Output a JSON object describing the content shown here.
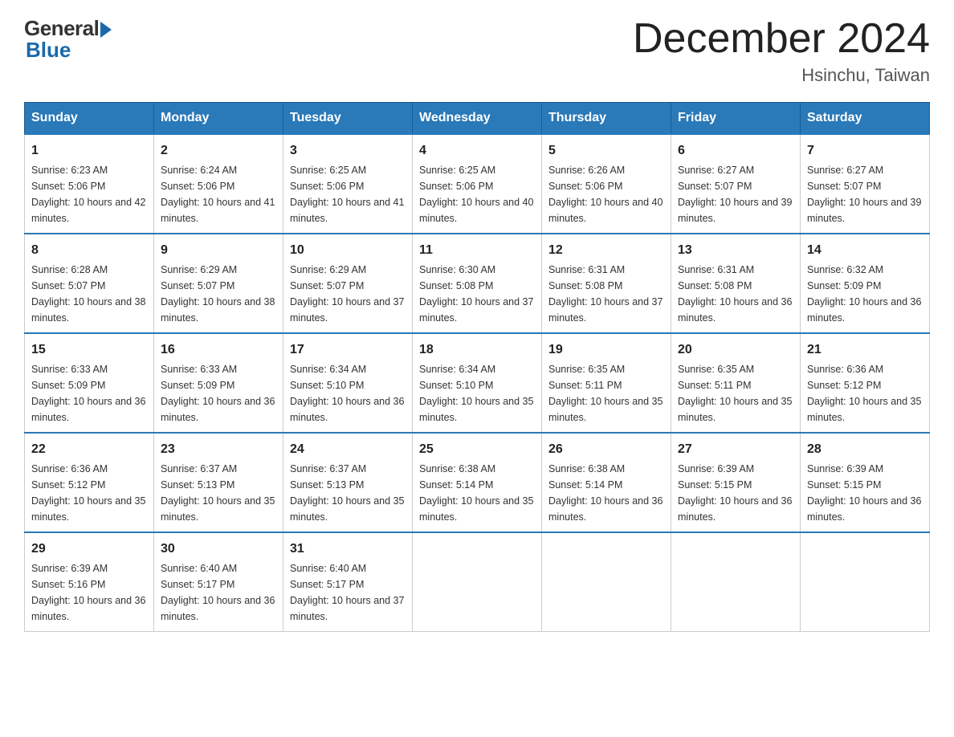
{
  "header": {
    "logo_general": "General",
    "logo_blue": "Blue",
    "month_title": "December 2024",
    "location": "Hsinchu, Taiwan"
  },
  "days_of_week": [
    "Sunday",
    "Monday",
    "Tuesday",
    "Wednesday",
    "Thursday",
    "Friday",
    "Saturday"
  ],
  "weeks": [
    [
      {
        "num": "1",
        "sunrise": "6:23 AM",
        "sunset": "5:06 PM",
        "daylight": "10 hours and 42 minutes."
      },
      {
        "num": "2",
        "sunrise": "6:24 AM",
        "sunset": "5:06 PM",
        "daylight": "10 hours and 41 minutes."
      },
      {
        "num": "3",
        "sunrise": "6:25 AM",
        "sunset": "5:06 PM",
        "daylight": "10 hours and 41 minutes."
      },
      {
        "num": "4",
        "sunrise": "6:25 AM",
        "sunset": "5:06 PM",
        "daylight": "10 hours and 40 minutes."
      },
      {
        "num": "5",
        "sunrise": "6:26 AM",
        "sunset": "5:06 PM",
        "daylight": "10 hours and 40 minutes."
      },
      {
        "num": "6",
        "sunrise": "6:27 AM",
        "sunset": "5:07 PM",
        "daylight": "10 hours and 39 minutes."
      },
      {
        "num": "7",
        "sunrise": "6:27 AM",
        "sunset": "5:07 PM",
        "daylight": "10 hours and 39 minutes."
      }
    ],
    [
      {
        "num": "8",
        "sunrise": "6:28 AM",
        "sunset": "5:07 PM",
        "daylight": "10 hours and 38 minutes."
      },
      {
        "num": "9",
        "sunrise": "6:29 AM",
        "sunset": "5:07 PM",
        "daylight": "10 hours and 38 minutes."
      },
      {
        "num": "10",
        "sunrise": "6:29 AM",
        "sunset": "5:07 PM",
        "daylight": "10 hours and 37 minutes."
      },
      {
        "num": "11",
        "sunrise": "6:30 AM",
        "sunset": "5:08 PM",
        "daylight": "10 hours and 37 minutes."
      },
      {
        "num": "12",
        "sunrise": "6:31 AM",
        "sunset": "5:08 PM",
        "daylight": "10 hours and 37 minutes."
      },
      {
        "num": "13",
        "sunrise": "6:31 AM",
        "sunset": "5:08 PM",
        "daylight": "10 hours and 36 minutes."
      },
      {
        "num": "14",
        "sunrise": "6:32 AM",
        "sunset": "5:09 PM",
        "daylight": "10 hours and 36 minutes."
      }
    ],
    [
      {
        "num": "15",
        "sunrise": "6:33 AM",
        "sunset": "5:09 PM",
        "daylight": "10 hours and 36 minutes."
      },
      {
        "num": "16",
        "sunrise": "6:33 AM",
        "sunset": "5:09 PM",
        "daylight": "10 hours and 36 minutes."
      },
      {
        "num": "17",
        "sunrise": "6:34 AM",
        "sunset": "5:10 PM",
        "daylight": "10 hours and 36 minutes."
      },
      {
        "num": "18",
        "sunrise": "6:34 AM",
        "sunset": "5:10 PM",
        "daylight": "10 hours and 35 minutes."
      },
      {
        "num": "19",
        "sunrise": "6:35 AM",
        "sunset": "5:11 PM",
        "daylight": "10 hours and 35 minutes."
      },
      {
        "num": "20",
        "sunrise": "6:35 AM",
        "sunset": "5:11 PM",
        "daylight": "10 hours and 35 minutes."
      },
      {
        "num": "21",
        "sunrise": "6:36 AM",
        "sunset": "5:12 PM",
        "daylight": "10 hours and 35 minutes."
      }
    ],
    [
      {
        "num": "22",
        "sunrise": "6:36 AM",
        "sunset": "5:12 PM",
        "daylight": "10 hours and 35 minutes."
      },
      {
        "num": "23",
        "sunrise": "6:37 AM",
        "sunset": "5:13 PM",
        "daylight": "10 hours and 35 minutes."
      },
      {
        "num": "24",
        "sunrise": "6:37 AM",
        "sunset": "5:13 PM",
        "daylight": "10 hours and 35 minutes."
      },
      {
        "num": "25",
        "sunrise": "6:38 AM",
        "sunset": "5:14 PM",
        "daylight": "10 hours and 35 minutes."
      },
      {
        "num": "26",
        "sunrise": "6:38 AM",
        "sunset": "5:14 PM",
        "daylight": "10 hours and 36 minutes."
      },
      {
        "num": "27",
        "sunrise": "6:39 AM",
        "sunset": "5:15 PM",
        "daylight": "10 hours and 36 minutes."
      },
      {
        "num": "28",
        "sunrise": "6:39 AM",
        "sunset": "5:15 PM",
        "daylight": "10 hours and 36 minutes."
      }
    ],
    [
      {
        "num": "29",
        "sunrise": "6:39 AM",
        "sunset": "5:16 PM",
        "daylight": "10 hours and 36 minutes."
      },
      {
        "num": "30",
        "sunrise": "6:40 AM",
        "sunset": "5:17 PM",
        "daylight": "10 hours and 36 minutes."
      },
      {
        "num": "31",
        "sunrise": "6:40 AM",
        "sunset": "5:17 PM",
        "daylight": "10 hours and 37 minutes."
      },
      null,
      null,
      null,
      null
    ]
  ]
}
